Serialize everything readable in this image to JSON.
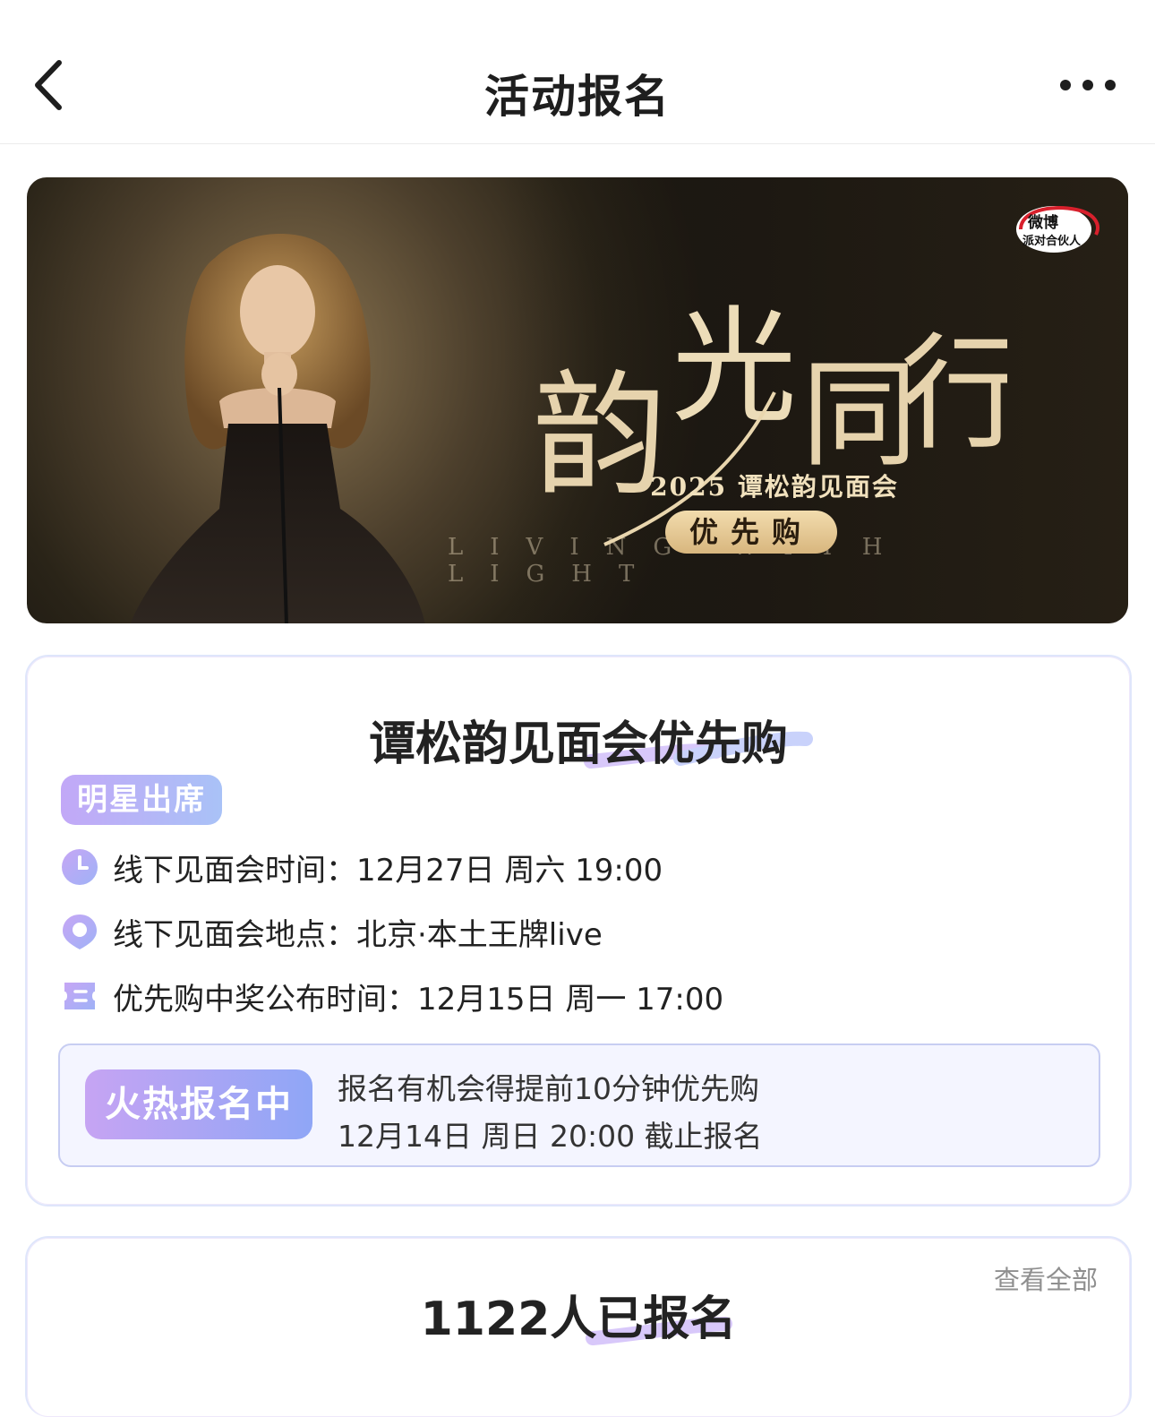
{
  "header": {
    "title": "活动报名"
  },
  "banner": {
    "title": "韵光同行",
    "title_chars": [
      "韵",
      "光",
      "同",
      "行"
    ],
    "english_line": "LIVING WITH LIGHT",
    "subtitle": "2025 谭松韵见面会",
    "presale_label": "优先购",
    "logo_text": "微博派对合伙人"
  },
  "event": {
    "title": "谭松韵见面会优先购",
    "badge": "明星出席",
    "rows": [
      {
        "icon": "clock-icon",
        "text": "线下见面会时间：12月27日 周六 19:00"
      },
      {
        "icon": "location-icon",
        "text": "线下见面会地点：北京·本土王牌live"
      },
      {
        "icon": "ticket-icon",
        "text": "优先购中奖公布时间：12月15日 周一 17:00"
      }
    ],
    "status_label": "火热报名中",
    "status_line1": "报名有机会得提前10分钟优先购",
    "status_line2": "12月14日 周日 20:00 截止报名"
  },
  "signup": {
    "title": "1122人已报名",
    "view_all": "查看全部"
  },
  "colors": {
    "accent_purple": "#b9a2f5",
    "accent_blue": "#8fa6f6",
    "gold": "#e0c18d"
  }
}
